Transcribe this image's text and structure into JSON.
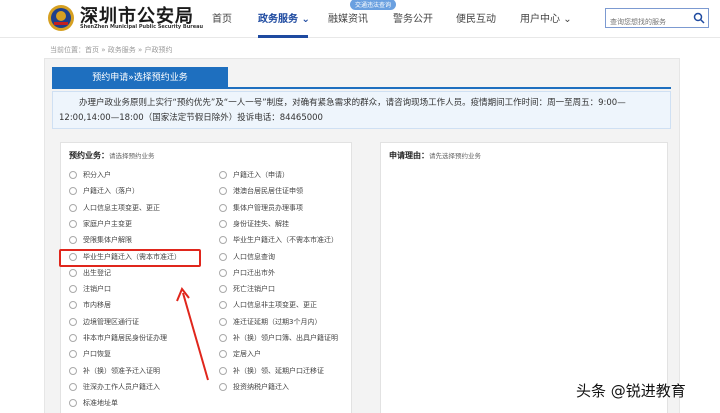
{
  "header": {
    "title": "深圳市公安局",
    "subtitle": "ShenZhen Municipal Public Security Bureau",
    "nav": [
      "首页",
      "政务服务",
      "融媒资讯",
      "警务公开",
      "便民互动",
      "用户中心"
    ],
    "badge": "交通违法查询",
    "search_placeholder": "查询您想找的服务",
    "colors": {
      "primary": "#1e4aa0",
      "tab": "#1e6fbf",
      "highlight": "#e0261c"
    }
  },
  "breadcrumb": "当前位置：首页 » 政务服务 » 户政预约",
  "tab_label": "预约申请»选择预约业务",
  "notice": {
    "line1": "办理户政业务原则上实行“预约优先”及“一人一号”制度，对确有紧急需求的群众，请咨询现场工作人员。疫情期间工作时间：周一至周五：9:00—",
    "line2": "12:00,14:00—18:00（国家法定节假日除外）投诉电话：84465000"
  },
  "left_box": {
    "title": "预约业务：",
    "hint": "请选择预约业务",
    "col1": [
      "积分入户",
      "户籍迁入（落户）",
      "人口信息主项变更、更正",
      "家庭户户主变更",
      "受限集体户解限",
      "毕业生户籍迁入（需本市准迁）",
      "出生登记",
      "注销户口",
      "市内移居",
      "边境管理区通行证",
      "非本市户籍居民身份证办理",
      "户口恢复",
      "补（换）领准予迁入证明",
      "驻深办工作人员户籍迁入",
      "标准地址单"
    ],
    "col2": [
      "户籍迁入（申请）",
      "港澳台居民居住证申领",
      "集体户管理员办理事项",
      "身份证挂失、解挂",
      "毕业生户籍迁入（不需本市准迁）",
      "人口信息查询",
      "户口迁出市外",
      "死亡注销户口",
      "人口信息非主项变更、更正",
      "准迁证延期（过期3个月内）",
      "补（换）领户口簿、出具户籍证明",
      "定居入户",
      "补（换）领、延期户口迁移证",
      "投资纳税户籍迁入"
    ]
  },
  "right_box": {
    "title": "申请理由：",
    "hint": "请先选择预约业务"
  },
  "watermark": "头条 @锐进教育"
}
